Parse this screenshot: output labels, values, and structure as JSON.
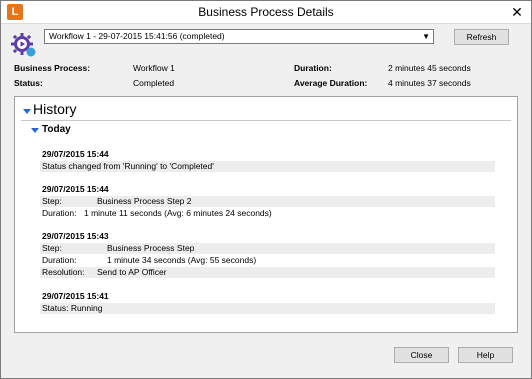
{
  "window": {
    "title": "Business Process Details",
    "app_icon_letter": "L",
    "close_glyph": "✕"
  },
  "header": {
    "workflow_select_value": "Workflow 1 - 29-07-2015 15:41:56 (completed)",
    "refresh_label": "Refresh",
    "business_process_label": "Business Process:",
    "business_process_value": "Workflow 1",
    "status_label": "Status:",
    "status_value": "Completed",
    "duration_label": "Duration:",
    "duration_value": "2 minutes 45 seconds",
    "avg_duration_label": "Average Duration:",
    "avg_duration_value": "4 minutes 37 seconds"
  },
  "history": {
    "title": "History",
    "group_title": "Today",
    "entries": [
      {
        "timestamp": "29/07/2015 15:44",
        "rows": [
          {
            "text": "Status changed from 'Running' to 'Completed'"
          }
        ]
      },
      {
        "timestamp": "29/07/2015 15:44",
        "rows": [
          {
            "key": "Step:",
            "value": "Business Process Step 2"
          },
          {
            "key": "Duration:",
            "value": "1 minute 11 seconds (Avg: 6 minutes 24 seconds)"
          }
        ]
      },
      {
        "timestamp": "29/07/2015 15:43",
        "rows": [
          {
            "key": "Step:",
            "value": "Business Process Step"
          },
          {
            "key": "Duration:",
            "value": "1 minute 34 seconds (Avg: 55 seconds)"
          },
          {
            "key": "Resolution:",
            "value": "Send to AP Officer"
          }
        ]
      },
      {
        "timestamp": "29/07/2015 15:41",
        "rows": [
          {
            "text": "Status: Running"
          }
        ]
      }
    ]
  },
  "footer": {
    "close_label": "Close",
    "help_label": "Help"
  },
  "colors": {
    "accent": "#2a66c7",
    "app_icon": "#e8741a",
    "process_icon": "#5b3fa6"
  }
}
